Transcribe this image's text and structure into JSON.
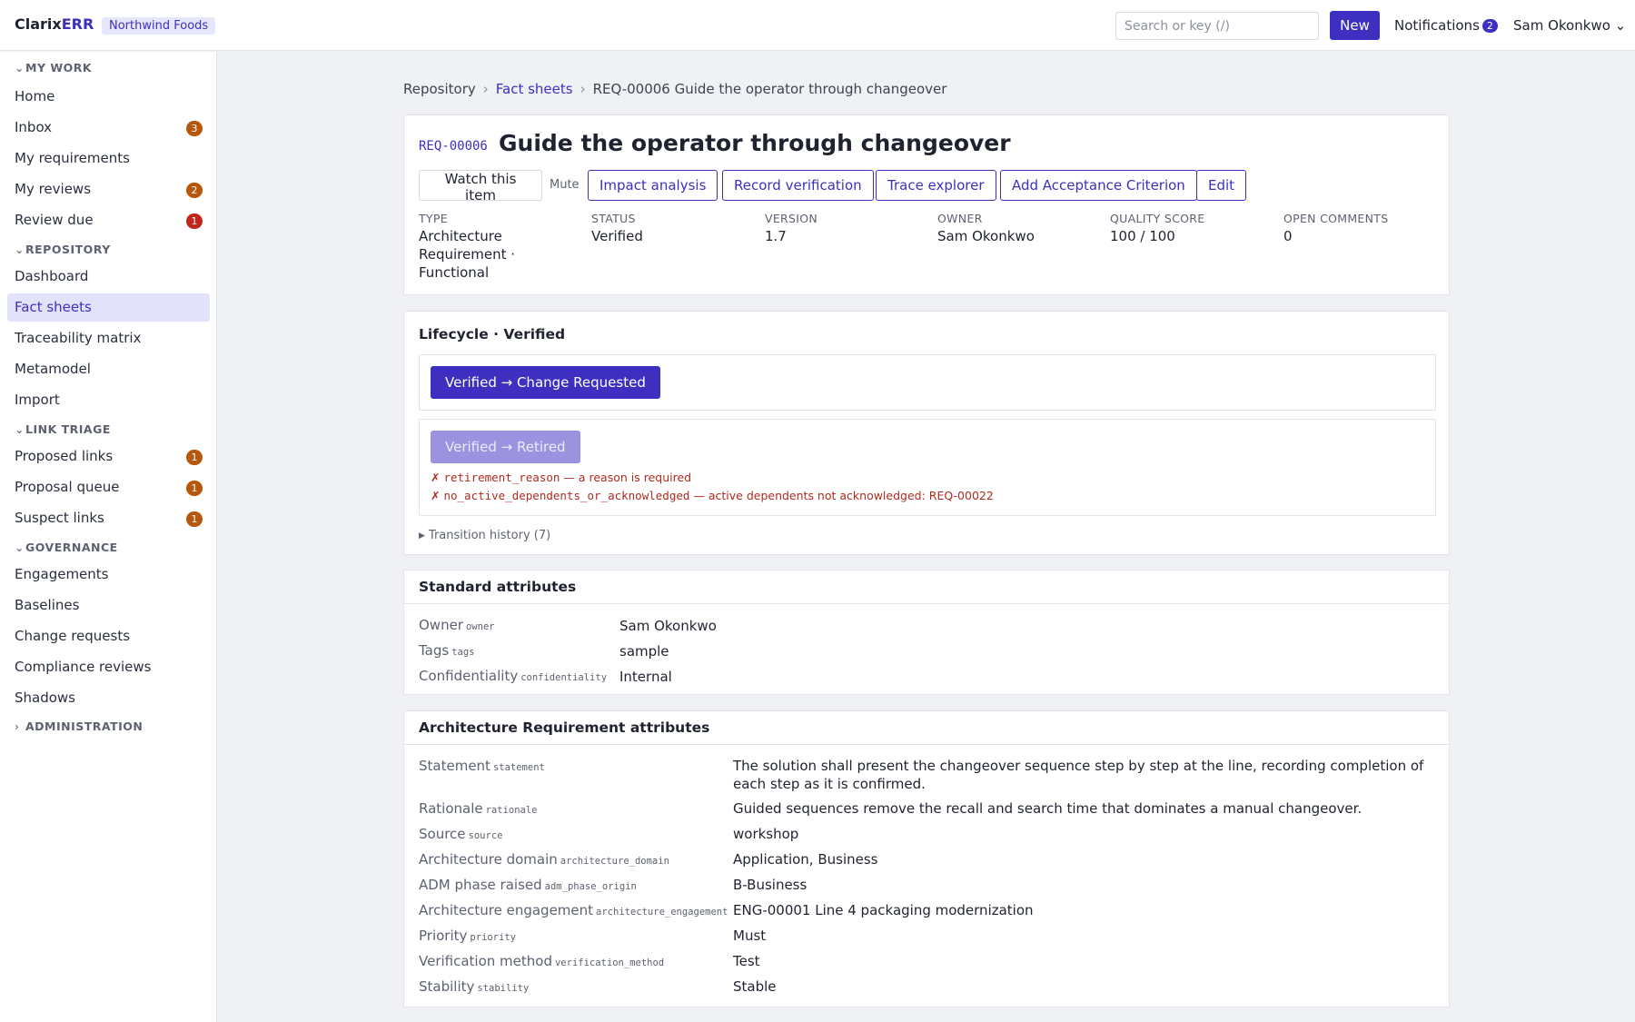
{
  "topbar": {
    "brand_a": "Clarix",
    "brand_b": "ERR",
    "org": "Northwind Foods",
    "search_placeholder": "Search or key (/)",
    "new_label": "New",
    "notifications_label": "Notifications",
    "notifications_count": "2",
    "user_name": "Sam Okonkwo",
    "user_chevron": "⌄"
  },
  "sidebar": {
    "sections": [
      {
        "label": "MY WORK",
        "chevron": "⌄"
      },
      {
        "label": "REPOSITORY",
        "chevron": "⌄"
      },
      {
        "label": "LINK TRIAGE",
        "chevron": "⌄"
      },
      {
        "label": "GOVERNANCE",
        "chevron": "⌄"
      },
      {
        "label": "ADMINISTRATION",
        "chevron": "›"
      }
    ],
    "items": [
      {
        "label": "Home"
      },
      {
        "label": "Inbox",
        "badge": "3"
      },
      {
        "label": "My requirements"
      },
      {
        "label": "My reviews",
        "badge": "2"
      },
      {
        "label": "Review due",
        "badge": "1"
      },
      {
        "label": "Dashboard"
      },
      {
        "label": "Fact sheets"
      },
      {
        "label": "Traceability matrix"
      },
      {
        "label": "Metamodel"
      },
      {
        "label": "Import"
      },
      {
        "label": "Proposed links",
        "badge": "1"
      },
      {
        "label": "Proposal queue",
        "badge": "1"
      },
      {
        "label": "Suspect links",
        "badge": "1"
      },
      {
        "label": "Engagements"
      },
      {
        "label": "Baselines"
      },
      {
        "label": "Change requests"
      },
      {
        "label": "Compliance reviews"
      },
      {
        "label": "Shadows"
      }
    ],
    "badge_orange": "#b6570c",
    "badge_red": "#c2261b",
    "active_item": "Fact sheets"
  },
  "breadcrumb": {
    "items": [
      "Repository",
      "Fact sheets",
      "REQ-00006 Guide the operator through changeover"
    ],
    "separator": "›"
  },
  "requirement": {
    "id": "REQ-00006",
    "title": "Guide the operator through changeover",
    "actions": {
      "watch": "Watch this item",
      "mute": "Mute",
      "impact": "Impact analysis",
      "record": "Record verification",
      "trace": "Trace explorer",
      "add_ac": "Add Acceptance Criterion",
      "edit": "Edit"
    },
    "meta": [
      {
        "label": "TYPE",
        "value": "Architecture Requirement · Functional"
      },
      {
        "label": "STATUS",
        "value": "Verified"
      },
      {
        "label": "VERSION",
        "value": "1.7"
      },
      {
        "label": "OWNER",
        "value": "Sam Okonkwo"
      },
      {
        "label": "QUALITY SCORE",
        "value": "100 / 100"
      },
      {
        "label": "OPEN COMMENTS",
        "value": "0"
      }
    ]
  },
  "lifecycle": {
    "title": "Lifecycle · Verified",
    "transition_1": "Verified → Change Requested",
    "transition_2": "Verified → Retired",
    "errors": [
      {
        "mark": "✗",
        "code": "retirement_reason",
        "text": " — a reason is required"
      },
      {
        "mark": "✗",
        "code": "no_active_dependents_or_acknowledged",
        "text": " — active dependents not acknowledged: REQ-00022"
      }
    ],
    "history": "Transition history (7)",
    "history_icon": "▶"
  },
  "standard_attributes": {
    "title": "Standard attributes",
    "rows": [
      {
        "label": "Owner",
        "key": "owner",
        "value": "Sam Okonkwo"
      },
      {
        "label": "Tags",
        "key": "tags",
        "value": "sample"
      },
      {
        "label": "Confidentiality",
        "key": "confidentiality",
        "value": "Internal"
      }
    ]
  },
  "arch_attributes": {
    "title": "Architecture Requirement attributes",
    "rows": [
      {
        "label": "Statement",
        "key": "statement",
        "value": "The solution shall present the changeover sequence step by step at the line, recording completion of each step as it is confirmed."
      },
      {
        "label": "Rationale",
        "key": "rationale",
        "value": "Guided sequences remove the recall and search time that dominates a manual changeover."
      },
      {
        "label": "Source",
        "key": "source",
        "value": "workshop"
      },
      {
        "label": "Architecture domain",
        "key": "architecture_domain",
        "value": "Application, Business"
      },
      {
        "label": "ADM phase raised",
        "key": "adm_phase_origin",
        "value": "B-Business"
      },
      {
        "label": "Architecture engagement",
        "key": "architecture_engagement",
        "value": "ENG-00001 Line 4 packaging modernization"
      },
      {
        "label": "Priority",
        "key": "priority",
        "value": "Must"
      },
      {
        "label": "Verification method",
        "key": "verification_method",
        "value": "Test"
      },
      {
        "label": "Stability",
        "key": "stability",
        "value": "Stable"
      }
    ]
  },
  "colors": {
    "accent": "#3d2fc0",
    "error": "#b02a20"
  }
}
